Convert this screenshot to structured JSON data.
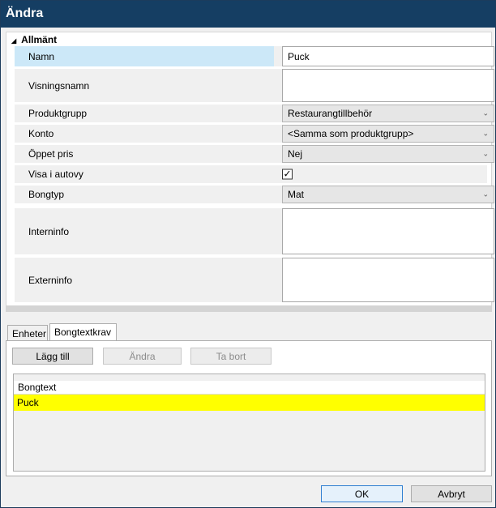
{
  "window": {
    "title": "Ändra"
  },
  "section": {
    "header": "Allmänt",
    "fields": [
      {
        "label": "Namn",
        "type": "text",
        "value": "Puck"
      },
      {
        "label": "Visningsnamn",
        "type": "text",
        "value": ""
      },
      {
        "label": "Produktgrupp",
        "type": "combo",
        "value": "Restaurangtillbehör"
      },
      {
        "label": "Konto",
        "type": "combo",
        "value": "<Samma som produktgrupp>"
      },
      {
        "label": "Öppet pris",
        "type": "combo",
        "value": "Nej"
      },
      {
        "label": "Visa i autovy",
        "type": "checkbox",
        "value": "✓"
      },
      {
        "label": "Bongtyp",
        "type": "combo",
        "value": "Mat"
      },
      {
        "label": "Interninfo",
        "type": "text",
        "value": ""
      },
      {
        "label": "Externinfo",
        "type": "text",
        "value": ""
      }
    ]
  },
  "tabs": [
    {
      "label": "Enheter"
    },
    {
      "label": "Bongtextkrav"
    }
  ],
  "panel": {
    "add_label": "Lägg till",
    "edit_label": "Ändra",
    "delete_label": "Ta bort",
    "grid": {
      "header": "Bongtext",
      "rows": [
        "Puck"
      ]
    }
  },
  "footer": {
    "ok_label": "OK",
    "cancel_label": "Avbryt"
  }
}
